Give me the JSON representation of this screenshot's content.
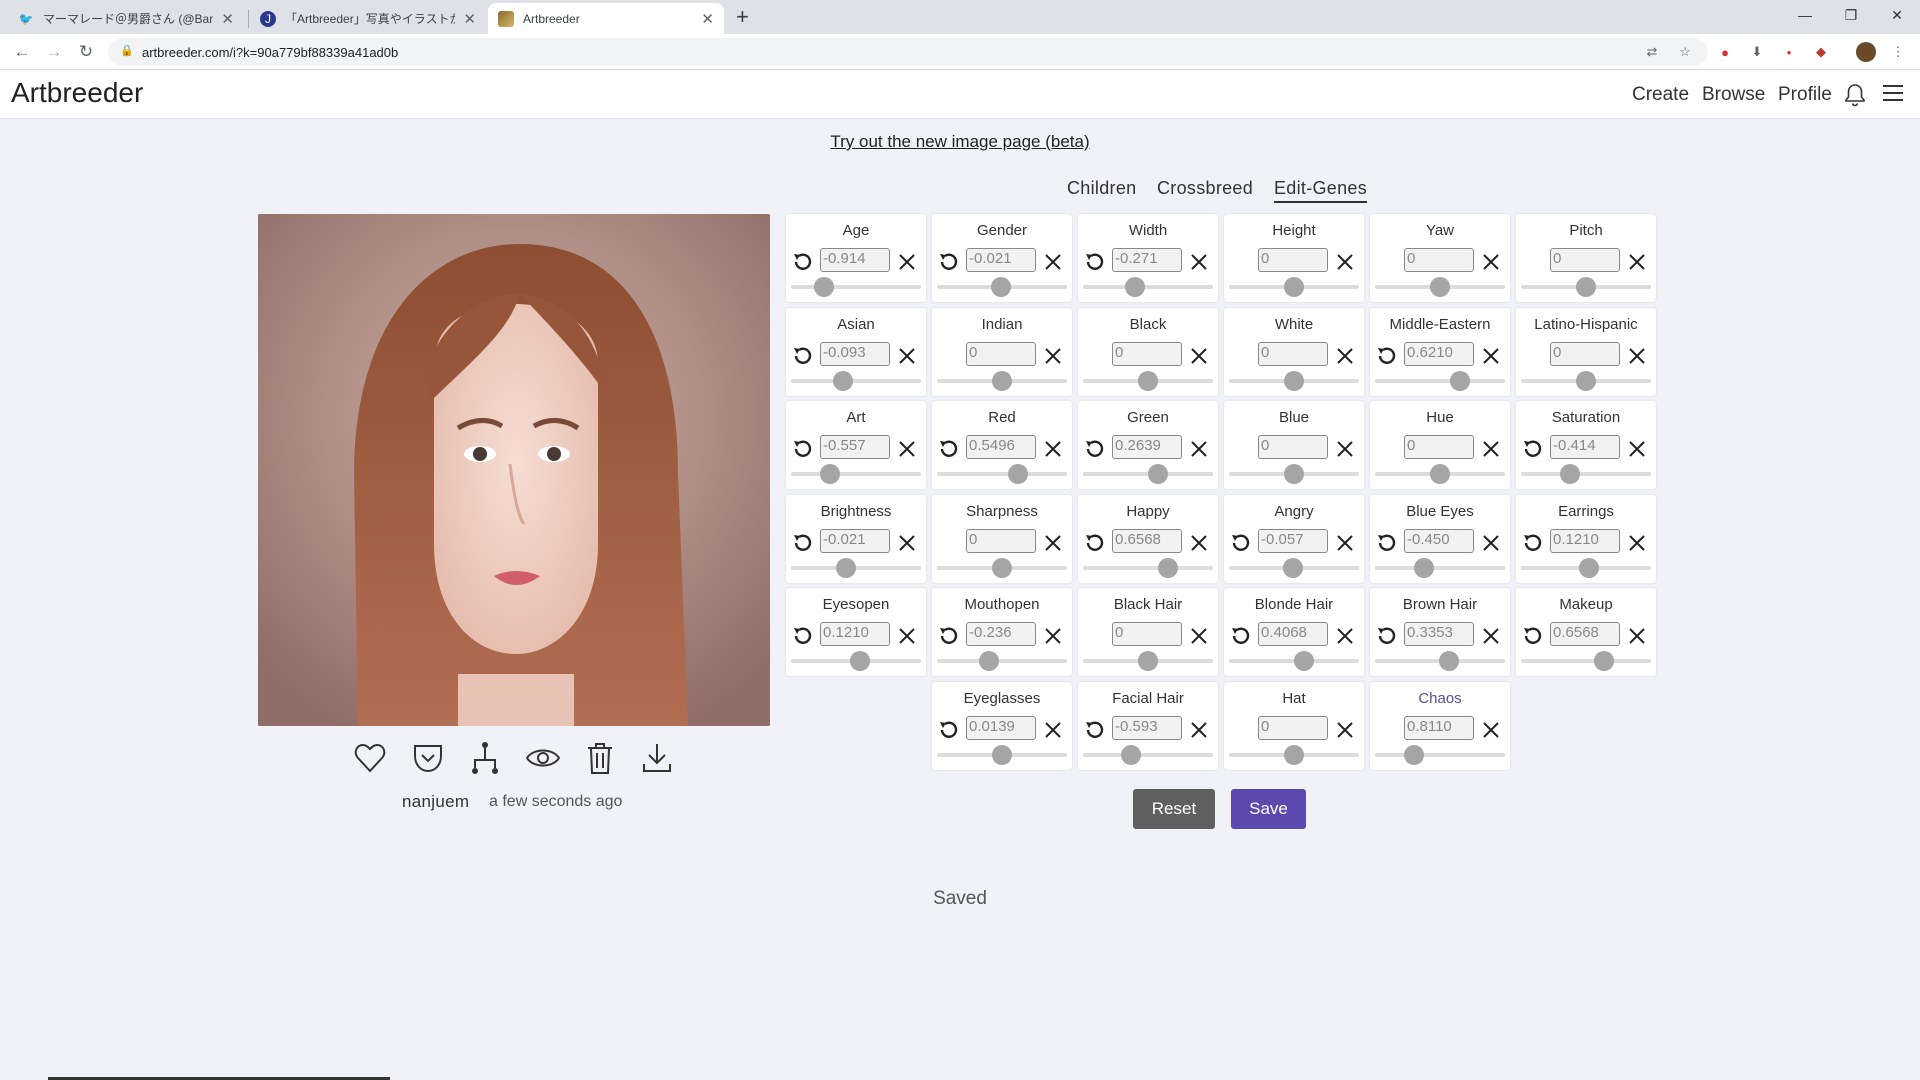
{
  "browser": {
    "tabs": [
      {
        "title": "マーマレード＠男爵さん (@Baron_Ma",
        "icon": "twitter-icon"
      },
      {
        "title": "「Artbreeder」写真やイラストからパラ",
        "icon": "site-icon"
      },
      {
        "title": "Artbreeder",
        "icon": "artbreeder-icon"
      }
    ],
    "url": "artbreeder.com/i?k=90a779bf88339a41ad0b"
  },
  "header": {
    "logo": "Artbreeder",
    "nav": [
      "Create",
      "Browse",
      "Profile"
    ]
  },
  "beta_link": "Try out the new image page (beta)",
  "modes": [
    "Children",
    "Crossbreed",
    "Edit-Genes"
  ],
  "active_mode": "Edit-Genes",
  "image": {
    "author": "nanjuem",
    "time": "a few seconds ago"
  },
  "genes": [
    {
      "name": "Age",
      "value": "-0.914",
      "slider": 0.25
    },
    {
      "name": "Gender",
      "value": "-0.021",
      "slider": 0.49
    },
    {
      "name": "Width",
      "value": "-0.271",
      "slider": 0.4
    },
    {
      "name": "Height",
      "value": "0",
      "slider": 0.5
    },
    {
      "name": "Yaw",
      "value": "0",
      "slider": 0.5
    },
    {
      "name": "Pitch",
      "value": "0",
      "slider": 0.5
    },
    {
      "name": "Asian",
      "value": "-0.093",
      "slider": 0.4
    },
    {
      "name": "Indian",
      "value": "0",
      "slider": 0.5
    },
    {
      "name": "Black",
      "value": "0",
      "slider": 0.5
    },
    {
      "name": "White",
      "value": "0",
      "slider": 0.5
    },
    {
      "name": "Middle-Eastern",
      "value": "0.6210",
      "slider": 0.65
    },
    {
      "name": "Latino-Hispanic",
      "value": "0",
      "slider": 0.5
    },
    {
      "name": "Art",
      "value": "-0.557",
      "slider": 0.3
    },
    {
      "name": "Red",
      "value": "0.5496",
      "slider": 0.62
    },
    {
      "name": "Green",
      "value": "0.2639",
      "slider": 0.58
    },
    {
      "name": "Blue",
      "value": "0",
      "slider": 0.5
    },
    {
      "name": "Hue",
      "value": "0",
      "slider": 0.5
    },
    {
      "name": "Saturation",
      "value": "-0.414",
      "slider": 0.38
    },
    {
      "name": "Brightness",
      "value": "-0.021",
      "slider": 0.42
    },
    {
      "name": "Sharpness",
      "value": "0",
      "slider": 0.5
    },
    {
      "name": "Happy",
      "value": "0.6568",
      "slider": 0.65
    },
    {
      "name": "Angry",
      "value": "-0.057",
      "slider": 0.49
    },
    {
      "name": "Blue Eyes",
      "value": "-0.450",
      "slider": 0.38
    },
    {
      "name": "Earrings",
      "value": "0.1210",
      "slider": 0.52
    },
    {
      "name": "Eyesopen",
      "value": "0.1210",
      "slider": 0.53
    },
    {
      "name": "Mouthopen",
      "value": "-0.236",
      "slider": 0.4
    },
    {
      "name": "Black Hair",
      "value": "0",
      "slider": 0.5
    },
    {
      "name": "Blonde Hair",
      "value": "0.4068",
      "slider": 0.58
    },
    {
      "name": "Brown Hair",
      "value": "0.3353",
      "slider": 0.57
    },
    {
      "name": "Makeup",
      "value": "0.6568",
      "slider": 0.64
    },
    {
      "name": "Eyeglasses",
      "value": "0.0139",
      "slider": 0.5
    },
    {
      "name": "Facial Hair",
      "value": "-0.593",
      "slider": 0.37
    },
    {
      "name": "Hat",
      "value": "0",
      "slider": 0.5
    },
    {
      "name": "Chaos",
      "value": "0.8110",
      "slider": 0.3
    }
  ],
  "buttons": {
    "reset": "Reset",
    "save": "Save"
  },
  "status": "Saved",
  "colors": {
    "accent": "#5c49b0",
    "reset_button": "#5f5f5f",
    "background": "#f1f2f8"
  }
}
